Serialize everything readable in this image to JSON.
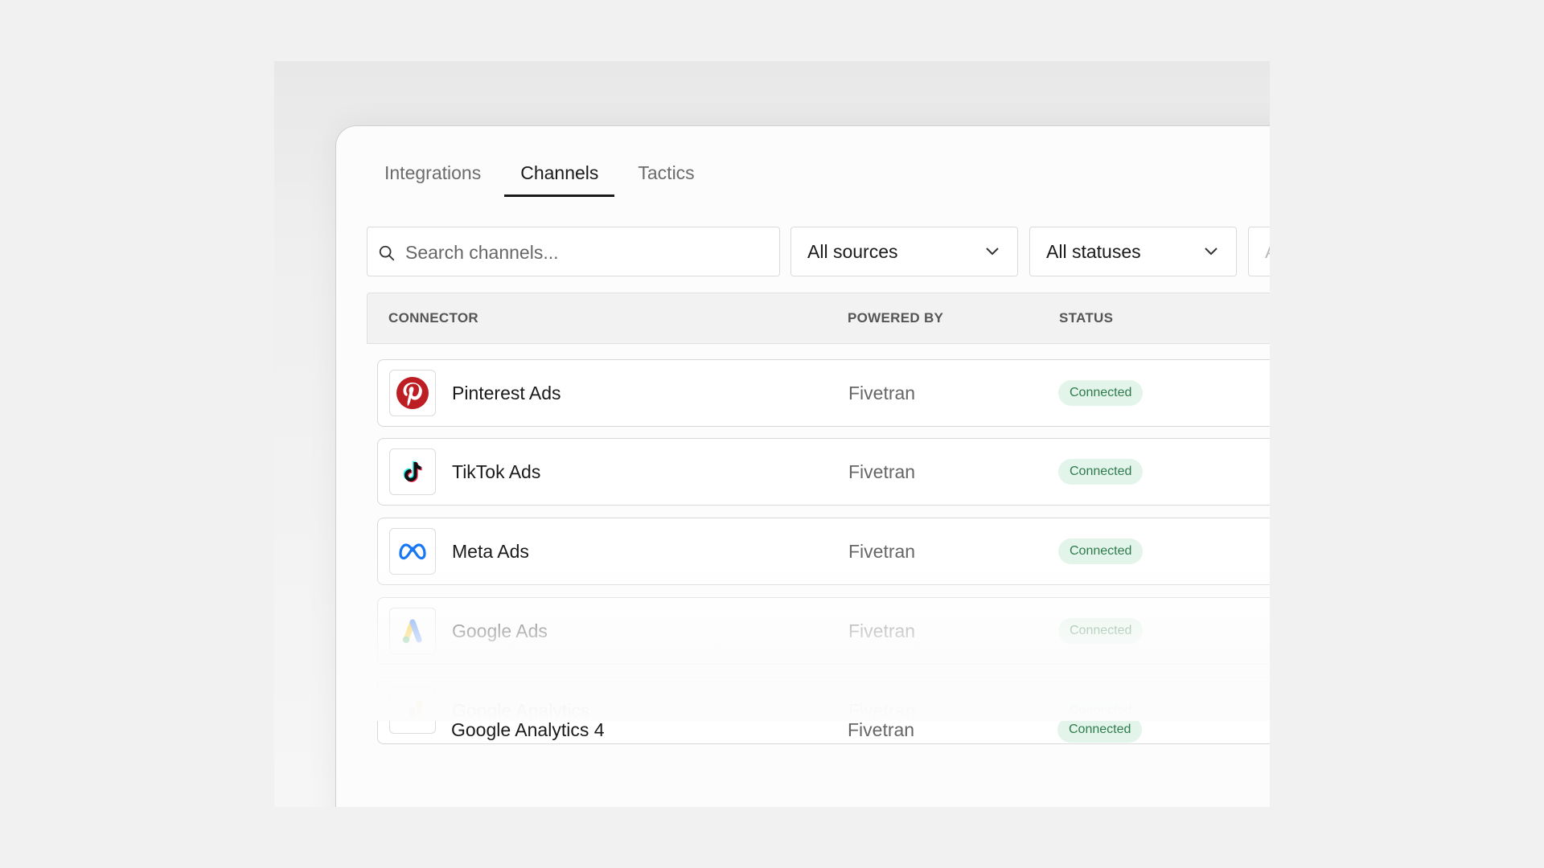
{
  "tabs": [
    {
      "label": "Integrations"
    },
    {
      "label": "Channels"
    },
    {
      "label": "Tactics"
    }
  ],
  "toolbar": {
    "search_placeholder": "Search channels...",
    "sources_selected": "All sources",
    "status_selected": "All statuses",
    "extra_selected": "A"
  },
  "table": {
    "columns": [
      "CONNECTOR",
      "POWERED BY",
      "STATUS"
    ],
    "rows": [
      {
        "name": "Pinterest Ads",
        "powered_by": "Fivetran",
        "status": "Connected",
        "icon": "pinterest-icon"
      },
      {
        "name": "TikTok Ads",
        "powered_by": "Fivetran",
        "status": "Connected",
        "icon": "tiktok-icon"
      },
      {
        "name": "Meta Ads",
        "powered_by": "Fivetran",
        "status": "Connected",
        "icon": "meta-icon"
      },
      {
        "name": "Google Ads",
        "powered_by": "Fivetran",
        "status": "Connected",
        "icon": "google-ads-icon"
      },
      {
        "name": "Google Analytics",
        "powered_by": "Fivetran",
        "status": "Connected",
        "icon": "google-analytics-icon"
      },
      {
        "name": "Google Analytics 4",
        "powered_by": "Fivetran",
        "status": "Connected",
        "icon": "google-analytics-icon"
      }
    ]
  },
  "colors": {
    "pinterest": "#bd1e24",
    "meta": "#1877f2",
    "badge_bg": "#e3f5ea",
    "badge_text": "#2f7a4c"
  }
}
